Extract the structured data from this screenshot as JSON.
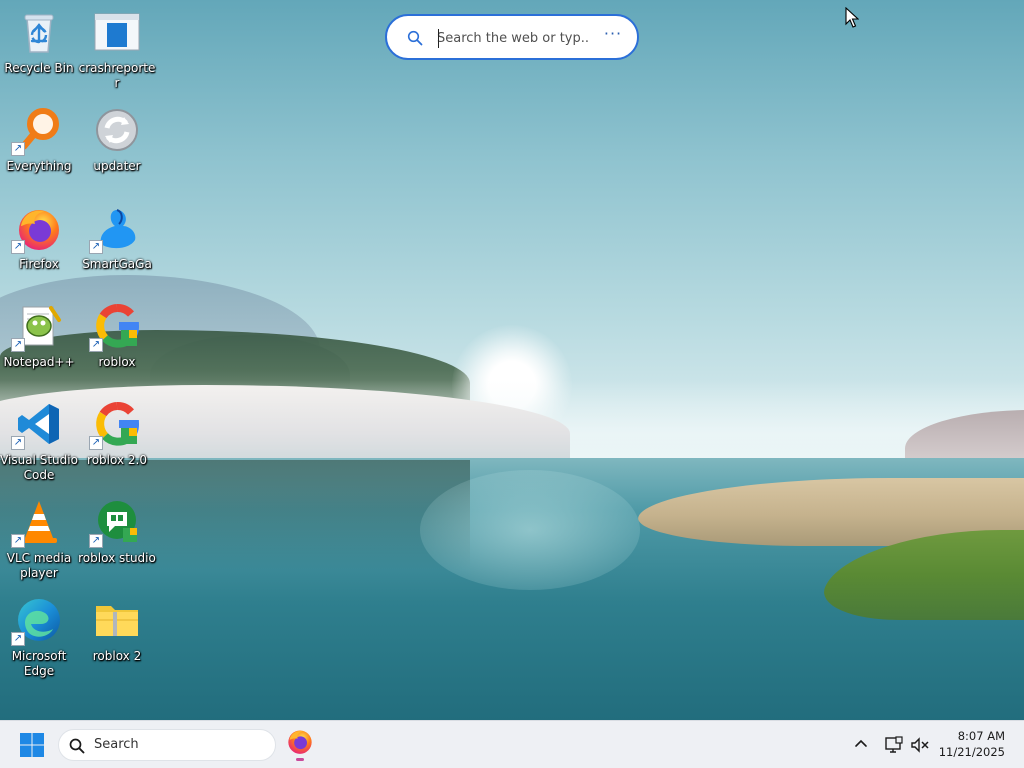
{
  "desktop": {
    "icons": [
      {
        "id": "recycle-bin",
        "label": "Recycle Bin",
        "icon": "recycle-bin-icon"
      },
      {
        "id": "crashreporter",
        "label": "crashreporter",
        "icon": "window-app-icon"
      },
      {
        "id": "everything",
        "label": "Everything",
        "icon": "magnifier-orange-icon"
      },
      {
        "id": "updater",
        "label": "updater",
        "icon": "refresh-circle-icon"
      },
      {
        "id": "firefox",
        "label": "Firefox",
        "icon": "firefox-icon"
      },
      {
        "id": "smartgaga",
        "label": "SmartGaGa",
        "icon": "swan-icon"
      },
      {
        "id": "notepadpp",
        "label": "Notepad++",
        "icon": "notepadpp-icon"
      },
      {
        "id": "roblox",
        "label": "roblox",
        "icon": "google-icon"
      },
      {
        "id": "vscode",
        "label": "Visual Studio Code",
        "icon": "vscode-icon"
      },
      {
        "id": "roblox-2-0",
        "label": "roblox 2.0",
        "icon": "google-icon"
      },
      {
        "id": "vlc",
        "label": "VLC media player",
        "icon": "vlc-cone-icon"
      },
      {
        "id": "roblox-studio",
        "label": "roblox studio",
        "icon": "google-chat-icon"
      },
      {
        "id": "edge",
        "label": "Microsoft Edge",
        "icon": "edge-icon"
      },
      {
        "id": "roblox-2",
        "label": "roblox 2",
        "icon": "zip-folder-icon"
      }
    ]
  },
  "search_widget": {
    "placeholder": "Search the web or typ...",
    "more_label": "···"
  },
  "taskbar": {
    "search_label": "Search",
    "pinned": [
      {
        "name": "Firefox",
        "icon": "firefox-icon",
        "active": true
      }
    ],
    "tray": {
      "chevron": "chevron-up-icon",
      "network": "display-network-icon",
      "volume": "volume-muted-icon"
    },
    "clock": {
      "time": "8:07 AM",
      "date": "11/21/2025"
    }
  },
  "colors": {
    "accent": "#2b6fd8",
    "taskbar_bg": "#eef0f4",
    "active_indicator": "#c94a9b"
  }
}
